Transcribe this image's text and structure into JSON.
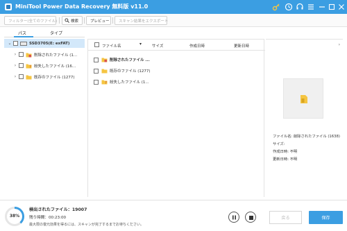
{
  "titlebar": {
    "title": "MiniTool Power Data Recovery 無料版 v11.0",
    "bg": "#3b9ee2",
    "icons": [
      "key-icon",
      "clock-icon",
      "headset-icon",
      "menu-icon",
      "minimize-icon",
      "maximize-icon",
      "close-icon"
    ]
  },
  "toolbar": {
    "filter_label": "フィルター(全てのファイル)",
    "search_label": "検索",
    "preview_label": "プレビュー",
    "export_label": "スキャン結果をエクスポート"
  },
  "left_panel": {
    "tabs": [
      "パス",
      "タイプ"
    ],
    "tree": [
      {
        "label": "SSD3705(E: exFAT)",
        "icon": "drive-icon",
        "expanded": true
      },
      {
        "label": "削除されたファイル (1...",
        "icon": "deleted-folder-icon"
      },
      {
        "label": "紛失したファイル (16...",
        "icon": "lost-folder-icon"
      },
      {
        "label": "既存のファイル (1277)",
        "icon": "folder-icon"
      }
    ]
  },
  "file_list": {
    "columns": [
      "ファイル名",
      "サイズ",
      "作成日時",
      "更新日時"
    ],
    "rows": [
      {
        "name": "削除されたファイル ...",
        "icon": "deleted-folder-icon"
      },
      {
        "name": "既存のファイル (1277)",
        "icon": "folder-icon"
      },
      {
        "name": "紛失したファイル (1...",
        "icon": "lost-folder-icon"
      }
    ]
  },
  "preview": {
    "info": [
      {
        "label": "ファイル名:",
        "value": "削除されたファイル (1638)"
      },
      {
        "label": "サイズ:",
        "value": ""
      },
      {
        "label": "作成日時:",
        "value": "不明"
      },
      {
        "label": "更新日時:",
        "value": "不明"
      }
    ]
  },
  "status": {
    "progress_percent": 38,
    "progress_label": "38%",
    "found_label": "検出されたファイル：",
    "found_count": "19007",
    "remaining_label": "残り時間：",
    "remaining_time": "00:23:00",
    "hint": "最大限の復元効果を得るには、スキャンが完了するまでお待ちください。",
    "back_label": "戻る",
    "save_label": "保存",
    "accent": "#3b9ee2"
  }
}
